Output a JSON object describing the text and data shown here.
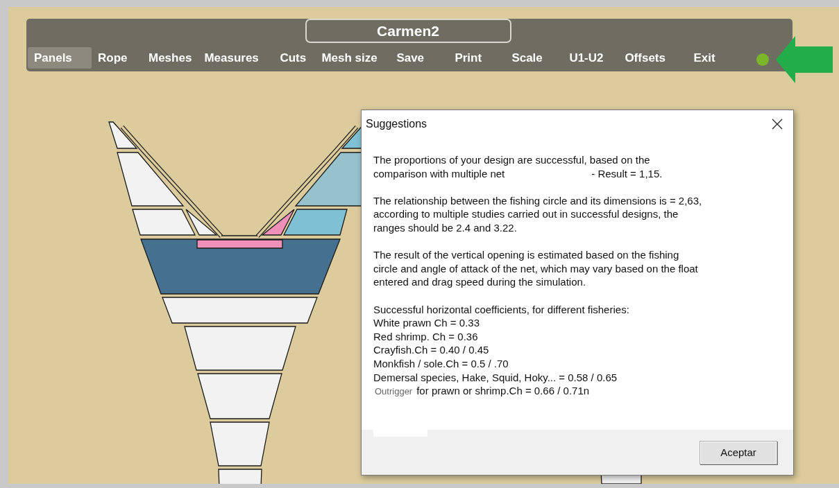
{
  "window": {
    "title": "Carmen2"
  },
  "menu": [
    {
      "label": "Panels",
      "selected": true
    },
    {
      "label": "Rope",
      "selected": false
    },
    {
      "label": "Meshes",
      "selected": false
    },
    {
      "label": "Measures",
      "selected": false
    },
    {
      "label": "Cuts",
      "selected": false
    },
    {
      "label": "Mesh size",
      "selected": false
    },
    {
      "label": "Save",
      "selected": false
    },
    {
      "label": "Print",
      "selected": false
    },
    {
      "label": "Scale",
      "selected": false
    },
    {
      "label": "U1-U2",
      "selected": false
    },
    {
      "label": "Offsets",
      "selected": false
    },
    {
      "label": "Exit",
      "selected": false
    }
  ],
  "dialog": {
    "title": "Suggestions",
    "paragraphs": [
      {
        "lines": [
          "The proportions of your design are successful, based on the",
          "comparison with multiple net                              - Result = 1,15."
        ]
      },
      {
        "lines": [
          "The relationship between the fishing circle and its dimensions is = 2,63,",
          "according to multiple studies carried out in successful designs, the",
          "ranges should be 2.4 and 3.22."
        ]
      },
      {
        "lines": [
          "The result of the vertical opening is estimated based on the fishing",
          "circle and angle of attack of the net, which may vary based on the float",
          "entered and drag speed during the simulation."
        ]
      }
    ],
    "coefficients": {
      "heading": "Successful horizontal coefficients, for different fisheries:",
      "items": [
        {
          "kind": "plain",
          "text": "White prawn Ch = 0.33"
        },
        {
          "kind": "plain",
          "text": "Red shrimp. Ch = 0.36"
        },
        {
          "kind": "plain",
          "text": "Crayfish.Ch = 0.40 / 0.45"
        },
        {
          "kind": "plain",
          "text": "Monkfish / sole.Ch = 0.5 / .70"
        },
        {
          "kind": "plain",
          "text": "Demersal species, Hake, Squid, Hoky... = 0.58 / 0.65"
        },
        {
          "kind": "prefixed",
          "prefix": "Outrigger",
          "text": "for prawn or shrimp.Ch = 0.66 / 0.71n"
        }
      ]
    },
    "buttons": [
      "Aceptar"
    ]
  }
}
